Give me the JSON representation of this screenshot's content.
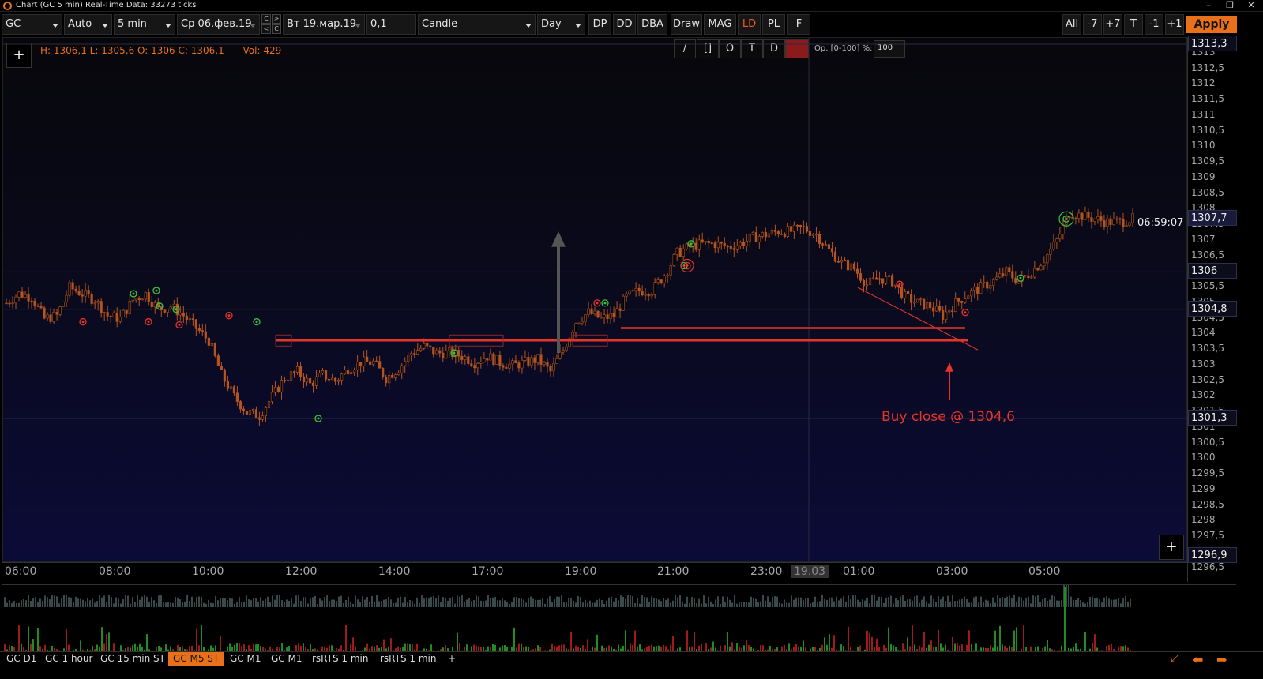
{
  "window": {
    "title": "Chart (GC 5 min) Real-Time Data: 33273 ticks",
    "controls": [
      "–",
      "❒",
      "✕"
    ]
  },
  "toolbar": {
    "symbol": "GC",
    "scale": "Auto",
    "timeframe": "5 min",
    "date_from": "Ср 06.фев.19",
    "nav_buttons": [
      "C",
      ">",
      "<",
      "C"
    ],
    "date_to": "Вт 19.мар.19",
    "tick_size": "0,1",
    "chart_type": "Candle",
    "period": "Day",
    "buttons": [
      "DP",
      "DD",
      "DBA",
      "Draw",
      "MAG",
      "LD",
      "PL",
      "F"
    ],
    "right_buttons": [
      "All",
      "-7",
      "+7",
      "T",
      "-1",
      "+1"
    ],
    "apply": "Apply"
  },
  "legend": {
    "ohlc": "H: 1306,1  L: 1305,6  O: 1306  C: 1306,1",
    "volume": "Vol: 429"
  },
  "draw_tools": {
    "buttons": [
      "/",
      "[]",
      "O",
      "T",
      "D"
    ],
    "opacity_label": "Op. [0-100] %:",
    "opacity_value": "100",
    "color": "#8b1a1a"
  },
  "chart": {
    "plus": "+",
    "annotation": "Buy close @ 1304,6",
    "clock": "06:59:07"
  },
  "chart_data": {
    "type": "candlestick",
    "instrument": "GC",
    "interval": "5 min",
    "ylim": [
      1296.5,
      1313.5
    ],
    "x_ticks": [
      "06:00",
      "08:00",
      "10:00",
      "12:00",
      "14:00",
      "17:00",
      "19:00",
      "21:00",
      "23:00",
      "19.03",
      "01:00",
      "03:00",
      "05:00"
    ],
    "y_ticks": [
      "1313,5",
      "1313",
      "1312,5",
      "1312",
      "1311,5",
      "1311",
      "1310,5",
      "1310",
      "1309,5",
      "1309",
      "1308,5",
      "1308",
      "1307,5",
      "1307",
      "1306,5",
      "1306",
      "1305,5",
      "1305",
      "1304,5",
      "1304",
      "1303,5",
      "1303",
      "1302,5",
      "1302",
      "1301,5",
      "1301",
      "1300,5",
      "1300",
      "1299,5",
      "1299",
      "1298,5",
      "1298",
      "1297,5",
      "1297",
      "1296,5"
    ],
    "price_labels": [
      "1313,3",
      "1307,7",
      "1306",
      "1304,8",
      "1301,3",
      "1296,9"
    ],
    "levels": [
      {
        "name": "support-line-1",
        "price": 1303.8
      },
      {
        "name": "support-line-2",
        "price": 1304.1
      }
    ],
    "close_path": [
      1305.0,
      1305.3,
      1305.2,
      1304.5,
      1304.6,
      1305.5,
      1305.3,
      1305.1,
      1304.6,
      1304.5,
      1305.1,
      1305.3,
      1304.8,
      1304.9,
      1304.6,
      1304.2,
      1303.8,
      1302.7,
      1302.0,
      1301.5,
      1301.4,
      1302.0,
      1302.6,
      1302.8,
      1302.4,
      1302.7,
      1302.5,
      1302.9,
      1303.1,
      1303.1,
      1302.6,
      1302.9,
      1303.4,
      1303.6,
      1303.4,
      1303.4,
      1303.3,
      1303.1,
      1303.3,
      1303.1,
      1303.0,
      1303.1,
      1303.2,
      1302.8,
      1303.5,
      1304.4,
      1304.7,
      1304.5,
      1304.6,
      1305.2,
      1305.4,
      1305.4,
      1305.9,
      1306.6,
      1306.8,
      1306.9,
      1306.9,
      1306.8,
      1306.9,
      1307.1,
      1307.2,
      1307.3,
      1307.3,
      1307.4,
      1307.2,
      1306.7,
      1306.3,
      1306.1,
      1305.6,
      1305.8,
      1305.7,
      1305.2,
      1305.0,
      1304.9,
      1304.6,
      1305.0,
      1305.3,
      1305.5,
      1305.7,
      1306.0,
      1305.7,
      1306.0,
      1306.4,
      1307.0,
      1307.9,
      1307.8,
      1307.7,
      1307.6,
      1307.6,
      1307.7
    ],
    "volume_note": "histogram bars below chart"
  },
  "price_axis": {
    "badges": [
      {
        "label": "1313,3",
        "price": 1313.3
      },
      {
        "label": "1307,7",
        "price": 1307.7
      },
      {
        "label": "1306",
        "price": 1306.0
      },
      {
        "label": "1304,8",
        "price": 1304.8
      },
      {
        "label": "1301,3",
        "price": 1301.3
      },
      {
        "label": "1296,9",
        "price": 1296.9
      }
    ]
  },
  "bottom_tabs": [
    "GC D1",
    "GC 1 hour",
    "GC 15 min ST",
    "GC M5 ST",
    "GC M1",
    "GC M1",
    "rsRTS 1 min",
    "rsRTS 1 min",
    "+"
  ],
  "active_tab": "GC M5 ST",
  "colors": {
    "accent": "#e8701a",
    "candle": "#b5541e",
    "level": "#e8342a",
    "buy_marker": "#3ec23e",
    "sell_marker": "#e8342a"
  }
}
